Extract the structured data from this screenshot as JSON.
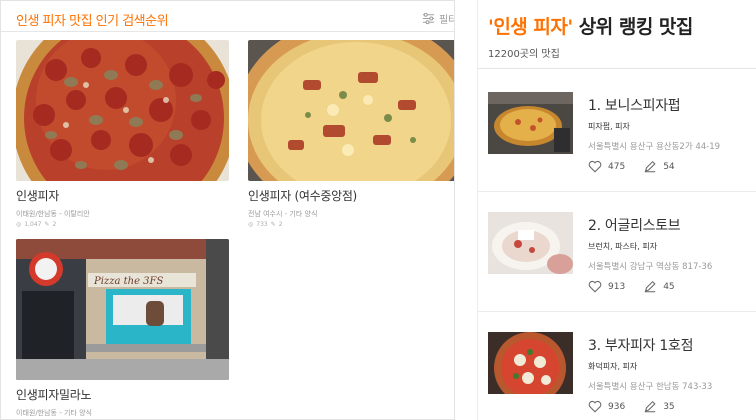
{
  "left": {
    "title": "인생 피자 맛집 인기 검색순위",
    "filter_label": "필터",
    "cards": [
      {
        "name": "인생피자",
        "sub": "이태원/한남동 - 이탈리안",
        "views": "1,047",
        "reviews": "2"
      },
      {
        "name": "인생피자 (여수중앙점)",
        "sub": "전남 여수시 - 기타 양식",
        "views": "733",
        "reviews": "2"
      },
      {
        "name": "인생피자밀라노",
        "sub": "이태원/한남동 - 기타 양식"
      }
    ],
    "storefront_sign": "Pizza the 3FS"
  },
  "right": {
    "title_keyword": "'인생 피자'",
    "title_rest": " 상위 랭킹 맛집",
    "count_text": "12200곳의 맛집",
    "restaurants": [
      {
        "title": "1. 보니스피자펍",
        "category": "피자펍, 피자",
        "address": "서울특별시 용산구 용산동2가 44-19",
        "likes": "475",
        "reviews": "54"
      },
      {
        "title": "2. 어글리스토브",
        "category": "브런치, 파스타, 피자",
        "address": "서울특별시 강남구 역삼동 817-36",
        "likes": "913",
        "reviews": "45"
      },
      {
        "title": "3. 부자피자 1호점",
        "category": "화덕피자, 피자",
        "address": "서울특별시 용산구 한남동 743-33",
        "likes": "936",
        "reviews": "35"
      }
    ]
  },
  "colors": {
    "accent": "#ff7100"
  }
}
